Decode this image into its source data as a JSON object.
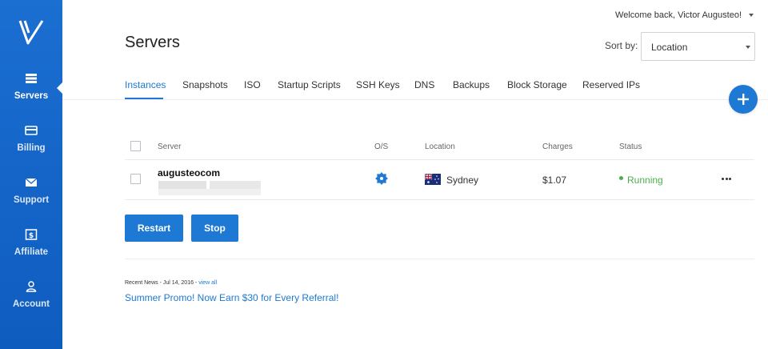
{
  "header": {
    "title": "Servers",
    "welcome": "Welcome back, Victor Augusteo!",
    "sort_label": "Sort by:",
    "sort_value": "Location"
  },
  "sidebar": {
    "items": [
      {
        "label": "Servers",
        "icon": "servers-icon",
        "active": true
      },
      {
        "label": "Billing",
        "icon": "credit-card-icon"
      },
      {
        "label": "Support",
        "icon": "envelope-icon"
      },
      {
        "label": "Affiliate",
        "icon": "dollar-icon"
      },
      {
        "label": "Account",
        "icon": "user-icon"
      }
    ]
  },
  "tabs": [
    "Instances",
    "Snapshots",
    "ISO",
    "Startup Scripts",
    "SSH Keys",
    "DNS",
    "Backups",
    "Block Storage",
    "Reserved IPs"
  ],
  "active_tab": "Instances",
  "table": {
    "columns": [
      "Server",
      "O/S",
      "Location",
      "Charges",
      "Status"
    ],
    "rows": [
      {
        "server": "augusteocom",
        "os_icon": "os-gear-icon",
        "location": "Sydney",
        "flag": "australia-flag-icon",
        "charges": "$1.07",
        "status": "Running"
      }
    ]
  },
  "actions": {
    "restart": "Restart",
    "stop": "Stop"
  },
  "news": {
    "meta": "Recent News - Jul 14, 2016 -",
    "view_all": "view all",
    "headline": "Summer Promo! Now Earn $30 for Every Referral!"
  },
  "colors": {
    "accent": "#1d79d3",
    "sidebar": "#1565c9",
    "running": "#4cae4c"
  }
}
